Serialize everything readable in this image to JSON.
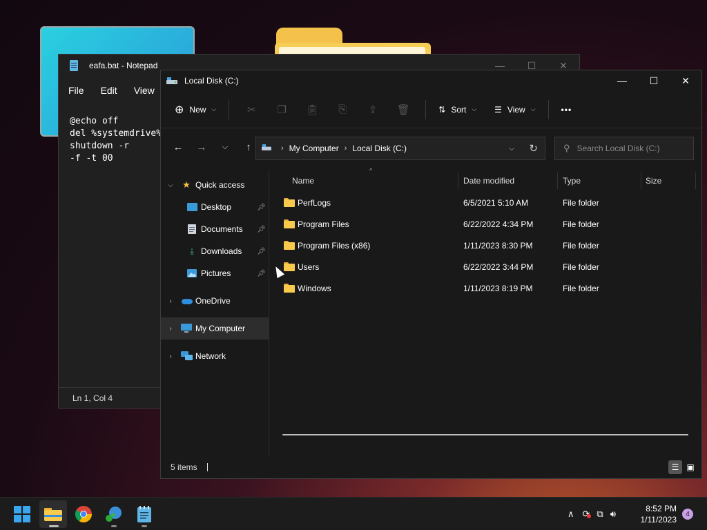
{
  "notepad": {
    "title": "eafa.bat - Notepad",
    "menu": [
      "File",
      "Edit",
      "View"
    ],
    "content": "@echo off\ndel %systemdrive%\nshutdown -r\n-f -t 00",
    "status": "Ln 1, Col 4"
  },
  "explorer": {
    "title": "Local Disk (C:)",
    "toolbar": {
      "new_label": "New",
      "sort_label": "Sort",
      "view_label": "View",
      "more": "•••"
    },
    "breadcrumb": [
      "My Computer",
      "Local Disk (C:)"
    ],
    "search_placeholder": "Search Local Disk (C:)",
    "sidebar": {
      "quick_access": "Quick access",
      "pinned": [
        "Desktop",
        "Documents",
        "Downloads",
        "Pictures"
      ],
      "onedrive": "OneDrive",
      "my_computer": "My Computer",
      "network": "Network"
    },
    "columns": {
      "name": "Name",
      "date": "Date modified",
      "type": "Type",
      "size": "Size"
    },
    "rows": [
      {
        "name": "PerfLogs",
        "date": "6/5/2021 5:10 AM",
        "type": "File folder"
      },
      {
        "name": "Program Files",
        "date": "6/22/2022 4:34 PM",
        "type": "File folder"
      },
      {
        "name": "Program Files (x86)",
        "date": "1/11/2023 8:30 PM",
        "type": "File folder"
      },
      {
        "name": "Users",
        "date": "6/22/2022 3:44 PM",
        "type": "File folder"
      },
      {
        "name": "Windows",
        "date": "1/11/2023 8:19 PM",
        "type": "File folder"
      }
    ],
    "status": "5 items"
  },
  "taskbar": {
    "time": "8:52 PM",
    "date": "1/11/2023",
    "notification_count": "4"
  },
  "colors": {
    "accent": "#4aa8e8",
    "folder": "#f7c94d"
  }
}
